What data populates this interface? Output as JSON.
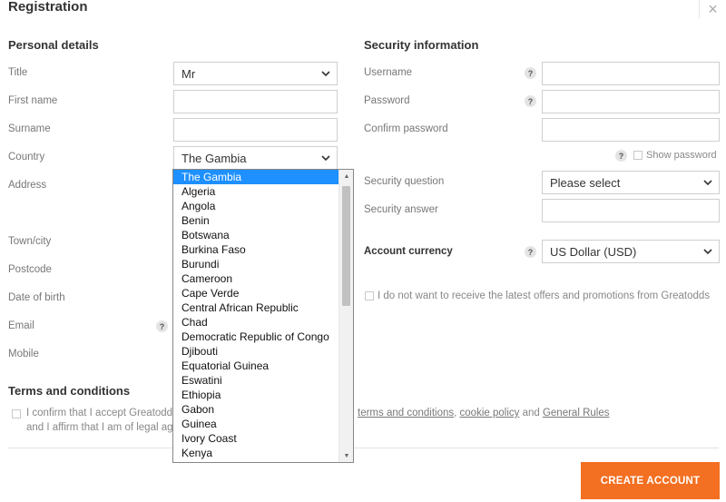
{
  "header": {
    "title": "Registration",
    "close_icon": "×"
  },
  "personal": {
    "section_title": "Personal details",
    "title_label": "Title",
    "title_value": "Mr",
    "first_name_label": "First name",
    "surname_label": "Surname",
    "country_label": "Country",
    "country_value": "The Gambia",
    "address_label": "Address",
    "town_label": "Town/city",
    "postcode_label": "Postcode",
    "dob_label": "Date of birth",
    "email_label": "Email",
    "mobile_label": "Mobile",
    "help_glyph": "?"
  },
  "security": {
    "section_title": "Security information",
    "username_label": "Username",
    "password_label": "Password",
    "confirm_label": "Confirm password",
    "show_password_label": "Show password",
    "question_label": "Security question",
    "question_value": "Please select",
    "answer_label": "Security answer",
    "currency_label": "Account currency",
    "currency_value": "US Dollar (USD)",
    "offers_label": "I do not want to receive the latest offers and promotions from Greatodds",
    "help_glyph": "?"
  },
  "terms": {
    "section_title": "Terms and conditions",
    "line1_prefix": "I confirm that I accept Greatodd",
    "terms_link": "terms and conditions",
    "comma": ",",
    "cookie_link": "cookie policy",
    "and_text": "and",
    "rules_link": "General Rules",
    "line2": "and I affirm that I am of legal ag"
  },
  "footer": {
    "create_button": "CREATE ACCOUNT"
  },
  "country_dropdown": {
    "options": [
      "The Gambia",
      "Algeria",
      "Angola",
      "Benin",
      "Botswana",
      "Burkina Faso",
      "Burundi",
      "Cameroon",
      "Cape Verde",
      "Central African Republic",
      "Chad",
      "Democratic Republic of Congo",
      "Djibouti",
      "Equatorial Guinea",
      "Eswatini",
      "Ethiopia",
      "Gabon",
      "Guinea",
      "Ivory Coast",
      "Kenya"
    ],
    "selected_index": 0
  },
  "colors": {
    "accent": "#f36f21",
    "selection": "#1e90ff"
  }
}
